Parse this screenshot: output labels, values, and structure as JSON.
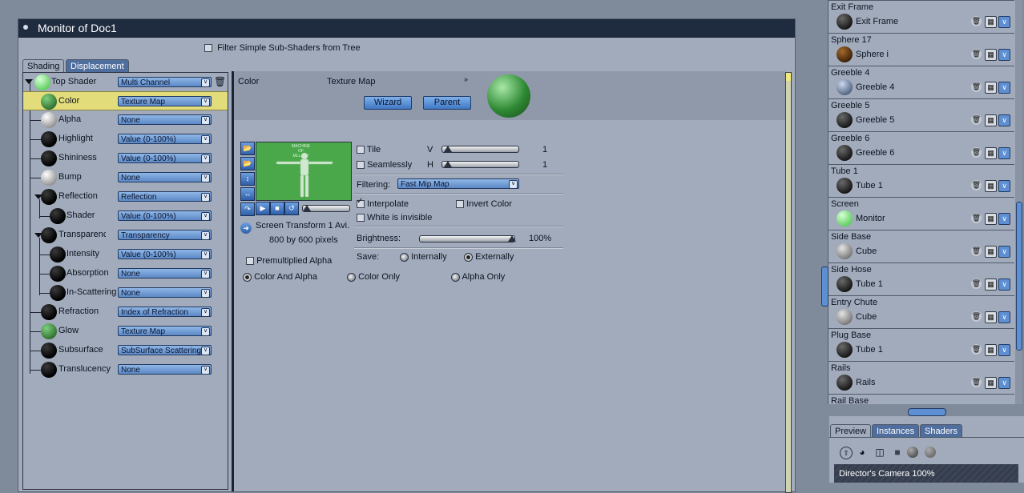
{
  "window": {
    "title": "Monitor of Doc1"
  },
  "filter": {
    "label": "Filter Simple Sub-Shaders from Tree"
  },
  "tabs": [
    {
      "label": "Shading"
    },
    {
      "label": "Displacement"
    }
  ],
  "tree": [
    {
      "label": "Top Shader",
      "value": "Multi Channel"
    },
    {
      "label": "Color",
      "value": "Texture Map"
    },
    {
      "label": "Alpha",
      "value": "None"
    },
    {
      "label": "Highlight",
      "value": "Value (0-100%)"
    },
    {
      "label": "Shininess",
      "value": "Value (0-100%)"
    },
    {
      "label": "Bump",
      "value": "None"
    },
    {
      "label": "Reflection",
      "value": "Reflection"
    },
    {
      "label": "Shader",
      "value": "Value (0-100%)"
    },
    {
      "label": "Transparency",
      "value": "Transparency"
    },
    {
      "label": "Intensity",
      "value": "Value (0-100%)"
    },
    {
      "label": "Absorption",
      "value": "None"
    },
    {
      "label": "In-Scattering",
      "value": "None"
    },
    {
      "label": "Refraction",
      "value": "Index of Refraction"
    },
    {
      "label": "Glow",
      "value": "Texture Map"
    },
    {
      "label": "Subsurface S",
      "value": "SubSurface Scattering"
    },
    {
      "label": "Translucency",
      "value": "None"
    }
  ],
  "editor": {
    "channel": "Color",
    "type": "Texture Map",
    "wizard": "Wizard",
    "parent": "Parent",
    "thumb_text": "MACHINE\nOF\nMLLANY",
    "tile": "Tile",
    "seamlessly": "Seamlessly",
    "v_label": "V",
    "h_label": "H",
    "v_value": "1",
    "h_value": "1",
    "filtering_label": "Filtering:",
    "filtering_value": "Fast Mip Map",
    "interpolate": "Interpolate",
    "invert_color": "Invert Color",
    "white_invisible": "White is invisible",
    "file_name": "Screen Transform 1 Avi.",
    "file_size": "800 by 600 pixels",
    "brightness_label": "Brightness:",
    "brightness_value": "100%",
    "brightness_fraction": 1.0,
    "save_label": "Save:",
    "internally": "Internally",
    "externally": "Externally",
    "premultiplied": "Premultiplied Alpha",
    "color_and_alpha": "Color And Alpha",
    "color_only": "Color Only",
    "alpha_only": "Alpha Only"
  },
  "objects": [
    {
      "name": "Exit Frame",
      "shader": "Exit Frame",
      "ball": "dgrey"
    },
    {
      "name": "Sphere 17",
      "shader": "Sphere i",
      "ball": "brown"
    },
    {
      "name": "Greeble 4",
      "shader": "Greeble 4",
      "ball": "blue"
    },
    {
      "name": "Greeble 5",
      "shader": "Greeble 5",
      "ball": "dgrey"
    },
    {
      "name": "Greeble 6",
      "shader": "Greeble 6",
      "ball": "dgrey"
    },
    {
      "name": "Tube 1",
      "shader": "Tube 1",
      "ball": "dgrey"
    },
    {
      "name": "Screen",
      "shader": "Monitor",
      "ball": "lgreen"
    },
    {
      "name": "Side Base",
      "shader": "Cube",
      "ball": "grey"
    },
    {
      "name": "Side Hose",
      "shader": "Tube 1",
      "ball": "dgrey"
    },
    {
      "name": "Entry Chute",
      "shader": "Cube",
      "ball": "grey"
    },
    {
      "name": "Plug Base",
      "shader": "Tube 1",
      "ball": "dgrey"
    },
    {
      "name": "Rails",
      "shader": "Rails",
      "ball": "dgrey"
    },
    {
      "name": "Rail Base",
      "shader": "",
      "ball": "dgrey"
    }
  ],
  "preview_tabs": [
    {
      "label": "Preview"
    },
    {
      "label": "Instances"
    },
    {
      "label": "Shaders"
    }
  ],
  "camera": {
    "label": "Director's Camera 100%"
  },
  "colors": {
    "accent": "#5d8fd2",
    "selected_row": "#e3dc7a",
    "title_bar": "#1f2b3f"
  }
}
